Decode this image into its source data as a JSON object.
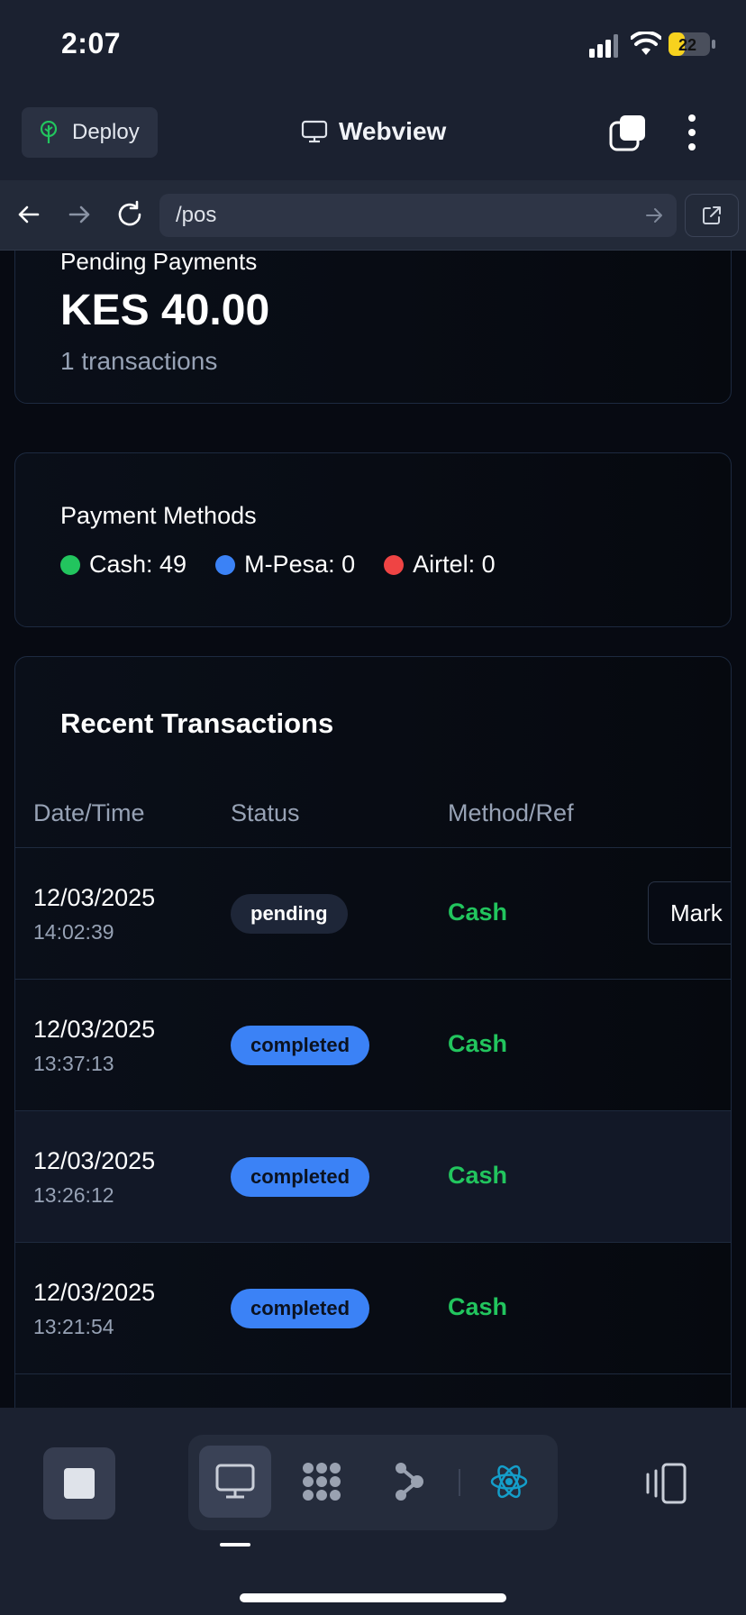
{
  "status_bar": {
    "time": "2:07",
    "battery": "22"
  },
  "top_bar": {
    "deploy_label": "Deploy",
    "title": "Webview"
  },
  "url_bar": {
    "url": "/pos"
  },
  "pending": {
    "title": "Pending Payments",
    "amount": "KES 40.00",
    "count": "1 transactions"
  },
  "methods": {
    "title": "Payment Methods",
    "items": [
      {
        "label": "Cash: 49",
        "color": "#22c55e"
      },
      {
        "label": "M-Pesa: 0",
        "color": "#3b82f6"
      },
      {
        "label": "Airtel: 0",
        "color": "#ef4444"
      }
    ]
  },
  "transactions": {
    "title": "Recent Transactions",
    "columns": [
      "Date/Time",
      "Status",
      "Method/Ref"
    ],
    "action_label": "Mark",
    "rows": [
      {
        "date": "12/03/2025",
        "time": "14:02:39",
        "status": "pending",
        "method": "Cash"
      },
      {
        "date": "12/03/2025",
        "time": "13:37:13",
        "status": "completed",
        "method": "Cash"
      },
      {
        "date": "12/03/2025",
        "time": "13:26:12",
        "status": "completed",
        "method": "Cash"
      },
      {
        "date": "12/03/2025",
        "time": "13:21:54",
        "status": "completed",
        "method": "Cash"
      }
    ]
  },
  "bottom_bar": {
    "icons": [
      "stop-icon",
      "monitor-icon",
      "grid-dots-icon",
      "graph-nodes-icon",
      "react-atom-icon",
      "device-frame-icon"
    ]
  },
  "colors": {
    "accent_blue": "#3b82f6",
    "success_green": "#22c55e",
    "danger_red": "#ef4444",
    "react_cyan": "#149eca"
  }
}
